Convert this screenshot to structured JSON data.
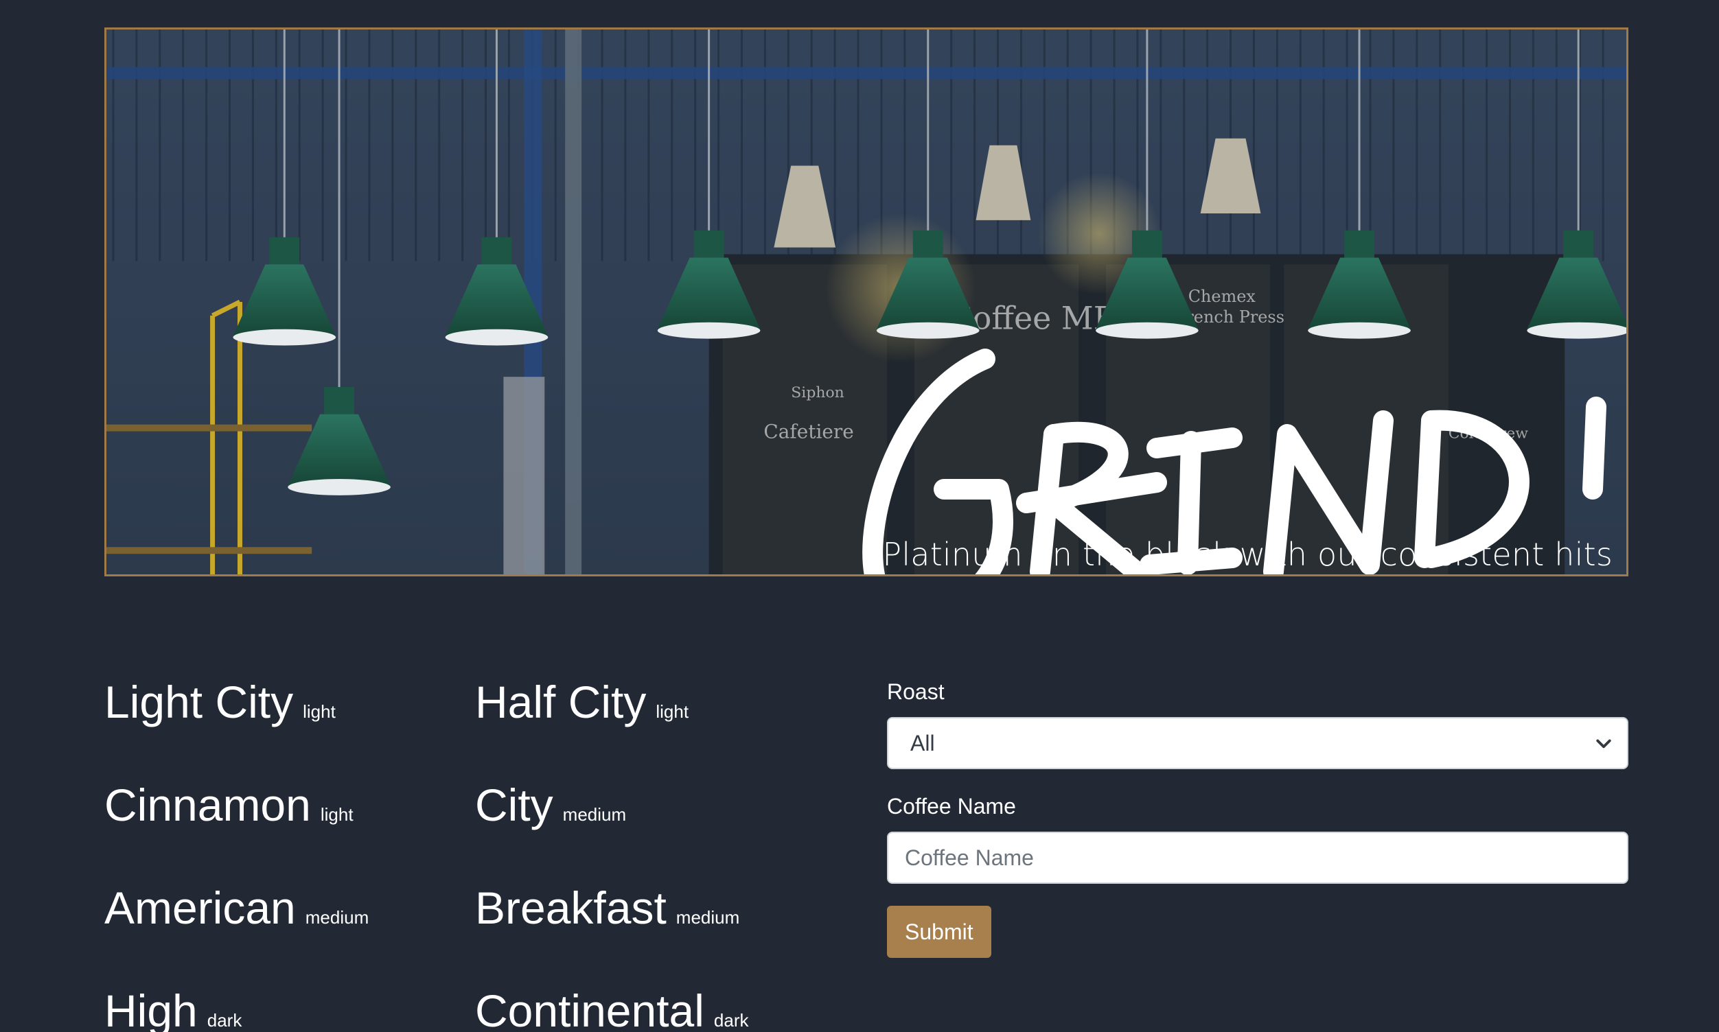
{
  "hero": {
    "logo_text": "GRINDIN",
    "tagline": "Platinum on the block with our consistent hits",
    "chalkboard_text": [
      "Coffee MENU",
      "Chemex",
      "French Press",
      "Cafetiere",
      "Siphon",
      "Cold Brew"
    ]
  },
  "roasts": [
    {
      "name": "Light City",
      "level": "light"
    },
    {
      "name": "Half City",
      "level": "light"
    },
    {
      "name": "Cinnamon",
      "level": "light"
    },
    {
      "name": "City",
      "level": "medium"
    },
    {
      "name": "American",
      "level": "medium"
    },
    {
      "name": "Breakfast",
      "level": "medium"
    },
    {
      "name": "High",
      "level": "dark"
    },
    {
      "name": "Continental",
      "level": "dark"
    }
  ],
  "form": {
    "roast_label": "Roast",
    "roast_selected": "All",
    "name_label": "Coffee Name",
    "name_placeholder": "Coffee Name",
    "submit_label": "Submit"
  },
  "colors": {
    "background": "#222935",
    "accent": "#a8804e",
    "hero_border": "#a07a48",
    "lamp_green": "#1f5a4a"
  }
}
